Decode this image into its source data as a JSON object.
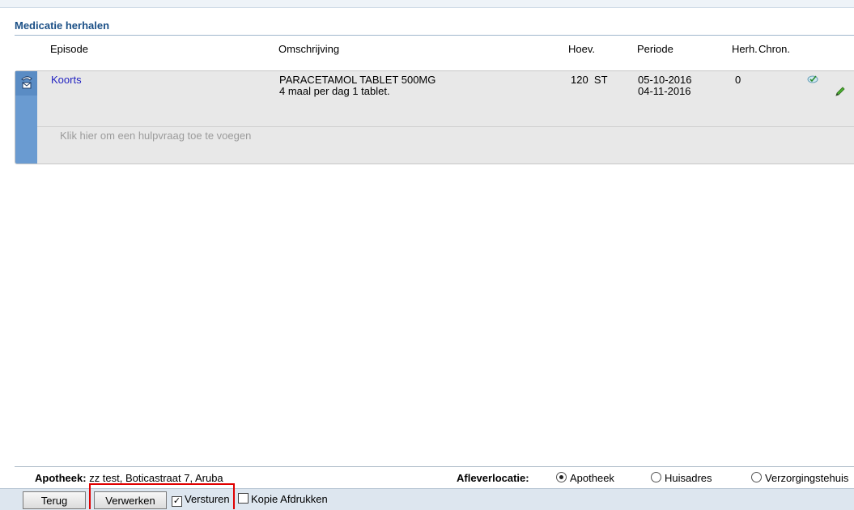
{
  "title": "Medicatie herhalen",
  "columns": {
    "episode": "Episode",
    "description": "Omschrijving",
    "quantity": "Hoev.",
    "period": "Periode",
    "repeats": "Herh.",
    "chronic": "Chron."
  },
  "row": {
    "episode": "Koorts",
    "medication": "PARACETAMOL TABLET 500MG",
    "dosage": "4 maal per dag 1 tablet.",
    "quantity": "120  ST",
    "period_start": "05-10-2016",
    "period_end": "04-11-2016",
    "repeats": "0"
  },
  "add_question_placeholder": "Klik hier om een hulpvraag toe te voegen",
  "footer": {
    "pharmacy_label": "Apotheek:",
    "pharmacy_value": "zz test, Boticastraat 7, Aruba",
    "delivery_label": "Afleverlocatie:",
    "delivery_options": [
      "Apotheek",
      "Huisadres",
      "Verzorgingstehuis"
    ],
    "delivery_selected": "Apotheek"
  },
  "toolbar": {
    "back_label": "Terug",
    "process_label": "Verwerken",
    "send_label": "Versturen",
    "send_checked": true,
    "print_copy_label": "Kopie Afdrukken",
    "print_copy_checked": false
  },
  "colors": {
    "title": "#1a4f86",
    "link": "#1f1fc0",
    "strip": "#6a9bd1",
    "highlight": "#e00000"
  }
}
